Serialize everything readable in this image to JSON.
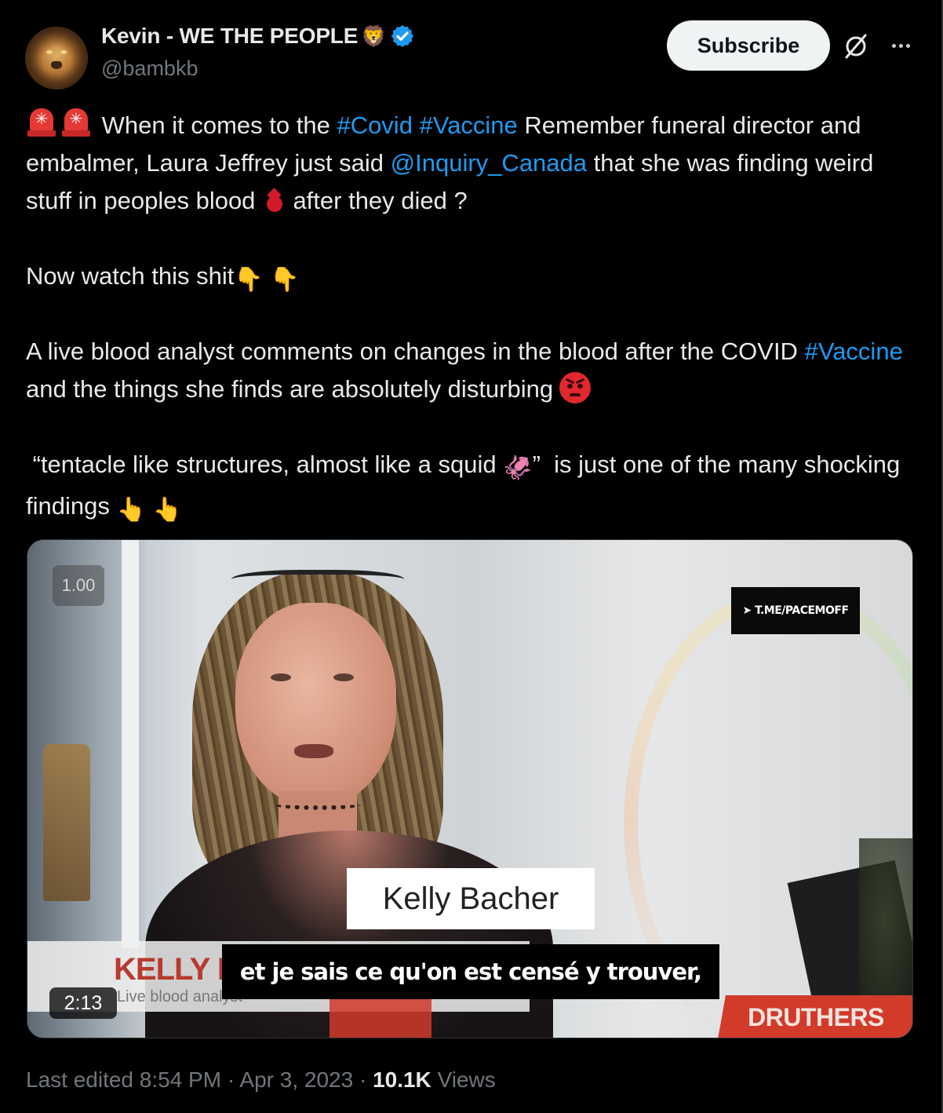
{
  "author": {
    "display_name": "Kevin - WE THE PEOPLE",
    "name_emoji": "🦁",
    "handle": "@bambkb",
    "verified": true,
    "avatar_icon": "lion-avatar"
  },
  "header_actions": {
    "subscribe_label": "Subscribe",
    "grok_icon": "slashed-circle-icon",
    "more_icon": "more-dots-icon"
  },
  "tweet": {
    "p1": {
      "pre": "When it comes to the",
      "tag1": "#Covid",
      "tag2": "#Vaccine",
      "mid": "Remember funeral director and embalmer, Laura Jeffrey just said",
      "mention": "@Inquiry_Canada",
      "post": "that she was finding weird stuff in peoples blood",
      "end": "after they died ?"
    },
    "p2": {
      "text": "Now watch this shit"
    },
    "p3": {
      "pre": "A live blood analyst comments on changes in the blood after the COVID",
      "tag": "#Vaccine",
      "post": "and the things she finds are absolutely disturbing"
    },
    "p4": {
      "pre": "“tentacle like structures, almost like a squid",
      "close_quote": "”",
      "post": "is just one of the many shocking findings"
    }
  },
  "video": {
    "speed": "1.00",
    "watermark": "T.ME/PACEMOFF",
    "namecard": "Kelly Bacher",
    "lower_third_name": "KELLY B",
    "lower_third_role": "Live blood analyst",
    "subtitle": "et je sais ce qu'on est censé y trouver,",
    "brand": "DRUTHERS",
    "duration": "2:13"
  },
  "meta": {
    "edited": "Last edited 8:54 PM",
    "sep1": "·",
    "date": "Apr 3, 2023",
    "sep2": "·",
    "views_count": "10.1K",
    "views_label": "Views"
  },
  "colors": {
    "background": "#000000",
    "text": "#e7e9ea",
    "muted": "#71767b",
    "link": "#1d9bf0",
    "verified": "#1d9bf0"
  }
}
